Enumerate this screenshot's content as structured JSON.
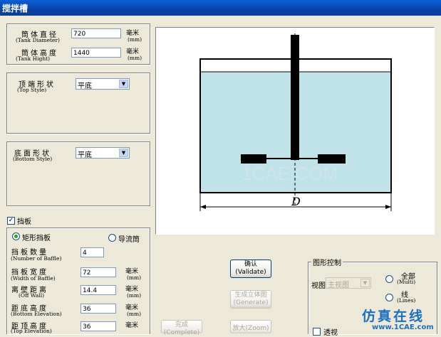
{
  "window": {
    "title": "搅拌槽"
  },
  "dims": {
    "diameter": {
      "label_cn": "筒体直径",
      "label_en": "(Tank Diameter)",
      "value": "720",
      "unit_cn": "毫米",
      "unit_en": "(mm)"
    },
    "height": {
      "label_cn": "筒体高度",
      "label_en": "(Tank Hight)",
      "value": "1440",
      "unit_cn": "毫米",
      "unit_en": "(mm)"
    }
  },
  "top_style": {
    "label_cn": "顶端形状",
    "label_en": "(Top Style)",
    "value": "平底"
  },
  "bottom_style": {
    "label_cn": "底面形状",
    "label_en": "(Bottom Style)",
    "value": "平底"
  },
  "baffle": {
    "checkbox_label": "挡板",
    "checked": true,
    "rect_label": "矩形挡板",
    "guide_label": "导流筒",
    "fields": [
      {
        "label_cn": "挡板数量",
        "label_en": "(Number of Baffle)",
        "value": "4",
        "unit_cn": "",
        "unit_en": ""
      },
      {
        "label_cn": "挡板宽度",
        "label_en": "(Width of Baffle)",
        "value": "72",
        "unit_cn": "毫米",
        "unit_en": "(mm)"
      },
      {
        "label_cn": "离壁距离",
        "label_en": "(Off Wall)",
        "value": "14.4",
        "unit_cn": "毫米",
        "unit_en": "(mm)"
      },
      {
        "label_cn": "距底高度",
        "label_en": "(Bottom Elevation)",
        "value": "36",
        "unit_cn": "毫米",
        "unit_en": "(mm)"
      },
      {
        "label_cn": "距顶高度",
        "label_en": "(Top Elevation)",
        "value": "36",
        "unit_cn": "毫米",
        "unit_en": "(mm)"
      }
    ]
  },
  "preview": {
    "dimension_label": "D",
    "watermark": "1CAE.COM"
  },
  "buttons": {
    "validate": {
      "line1": "确认",
      "line2": "(Validate)"
    },
    "generate": {
      "line1": "生成立体图",
      "line2": "(Generate)"
    },
    "complete": {
      "line1": "完成",
      "line2": "(Complete)"
    },
    "zoom": {
      "line1": "放大(Zoom)"
    }
  },
  "graphics": {
    "title": "图形控制",
    "view_label": "视图",
    "view_value": "主视图",
    "all_label": "全部",
    "all_en": "(Multi)",
    "line_label": "线",
    "line_en": "(Lines)",
    "perspective_label": "透视"
  },
  "brand": {
    "cn": "仿真在线",
    "url": "www.1CAE.com"
  },
  "colors": {
    "liquid": "#bfe3e8",
    "titlebar": "#0a5fd8",
    "brand_blue": "#1b6fc2"
  }
}
